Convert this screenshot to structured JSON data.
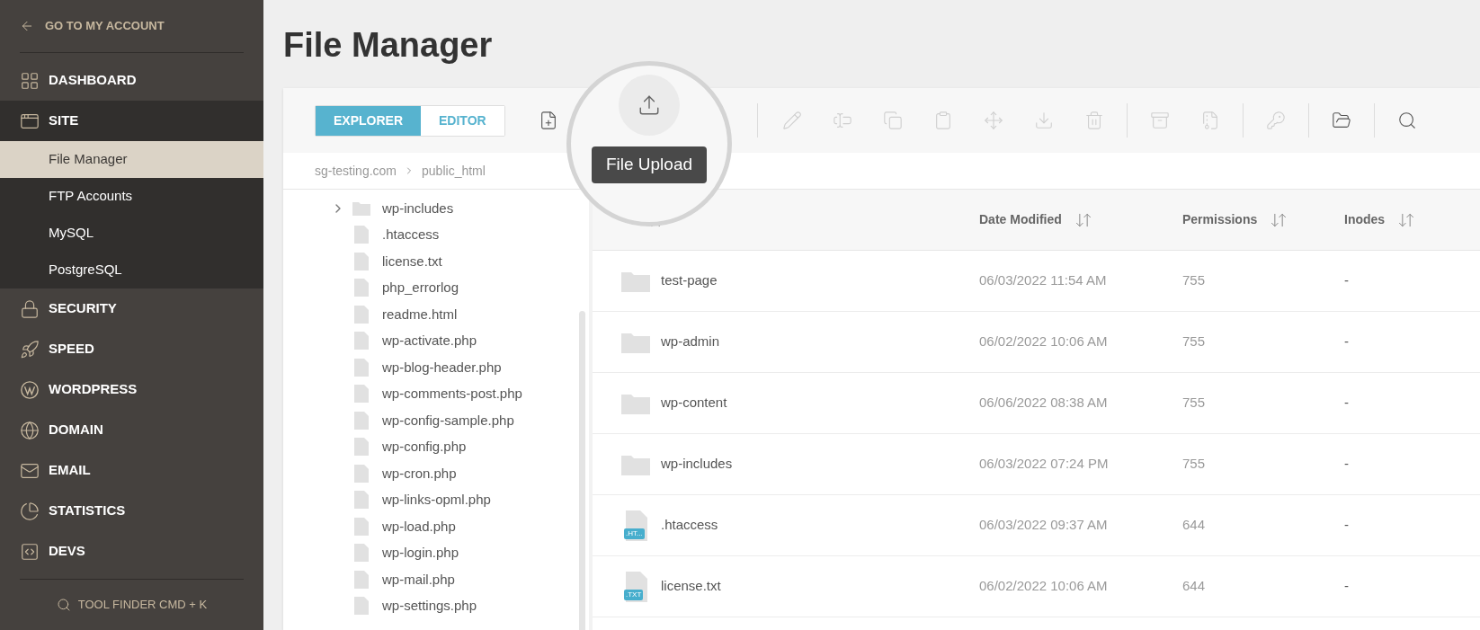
{
  "sidebar": {
    "back_link": "GO TO MY ACCOUNT",
    "items": [
      {
        "label": "DASHBOARD",
        "expanded": false
      },
      {
        "label": "SITE",
        "expanded": true,
        "children": [
          {
            "label": "File Manager",
            "selected": true
          },
          {
            "label": "FTP Accounts",
            "selected": false
          },
          {
            "label": "MySQL",
            "selected": false
          },
          {
            "label": "PostgreSQL",
            "selected": false
          }
        ]
      },
      {
        "label": "SECURITY",
        "expanded": false
      },
      {
        "label": "SPEED",
        "expanded": false
      },
      {
        "label": "WORDPRESS",
        "expanded": false
      },
      {
        "label": "DOMAIN",
        "expanded": false
      },
      {
        "label": "EMAIL",
        "expanded": false
      },
      {
        "label": "STATISTICS",
        "expanded": false
      },
      {
        "label": "DEVS",
        "expanded": false
      }
    ],
    "tool_finder": "TOOL FINDER CMD + K"
  },
  "page_title": "File Manager",
  "mode_tabs": [
    {
      "label": "EXPLORER",
      "selected": true
    },
    {
      "label": "EDITOR",
      "selected": false
    }
  ],
  "toolbar": {
    "tooltip": "File Upload",
    "groups": [
      [
        {
          "disabled": false
        }
      ],
      [
        {
          "disabled": true
        },
        {
          "disabled": true
        },
        {
          "disabled": true
        },
        {
          "disabled": true
        },
        {
          "disabled": true
        },
        {
          "disabled": true
        },
        {
          "disabled": true
        }
      ],
      [
        {
          "disabled": true
        },
        {
          "disabled": true
        }
      ],
      [
        {
          "disabled": true
        }
      ],
      [
        {
          "disabled": false
        }
      ],
      [
        {
          "disabled": false
        }
      ]
    ]
  },
  "breadcrumb": [
    "sg-testing.com",
    "public_html"
  ],
  "tree": [
    {
      "name": "wp-includes",
      "kind": "folder",
      "expanded": false
    },
    {
      "name": ".htaccess",
      "kind": "file"
    },
    {
      "name": "license.txt",
      "kind": "file"
    },
    {
      "name": "php_errorlog",
      "kind": "file"
    },
    {
      "name": "readme.html",
      "kind": "file"
    },
    {
      "name": "wp-activate.php",
      "kind": "file"
    },
    {
      "name": "wp-blog-header.php",
      "kind": "file"
    },
    {
      "name": "wp-comments-post.php",
      "kind": "file"
    },
    {
      "name": "wp-config-sample.php",
      "kind": "file"
    },
    {
      "name": "wp-config.php",
      "kind": "file"
    },
    {
      "name": "wp-cron.php",
      "kind": "file"
    },
    {
      "name": "wp-links-opml.php",
      "kind": "file"
    },
    {
      "name": "wp-load.php",
      "kind": "file"
    },
    {
      "name": "wp-login.php",
      "kind": "file"
    },
    {
      "name": "wp-mail.php",
      "kind": "file"
    },
    {
      "name": "wp-settings.php",
      "kind": "file"
    }
  ],
  "table": {
    "columns": [
      "Date Modified",
      "Permissions",
      "Inodes"
    ],
    "rows": [
      {
        "kind": "folder",
        "name": "test-page",
        "date": "06/03/2022 11:54 AM",
        "permissions": "755",
        "inodes": "-"
      },
      {
        "kind": "folder",
        "name": "wp-admin",
        "date": "06/02/2022 10:06 AM",
        "permissions": "755",
        "inodes": "-"
      },
      {
        "kind": "folder",
        "name": "wp-content",
        "date": "06/06/2022 08:38 AM",
        "permissions": "755",
        "inodes": "-"
      },
      {
        "kind": "folder",
        "name": "wp-includes",
        "date": "06/03/2022 07:24 PM",
        "permissions": "755",
        "inodes": "-"
      },
      {
        "kind": "file",
        "badge": ".HT...",
        "name": ".htaccess",
        "date": "06/03/2022 09:37 AM",
        "permissions": "644",
        "inodes": "-"
      },
      {
        "kind": "file",
        "badge": ".TXT",
        "name": "license.txt",
        "date": "06/02/2022 10:06 AM",
        "permissions": "644",
        "inodes": "-"
      }
    ]
  }
}
